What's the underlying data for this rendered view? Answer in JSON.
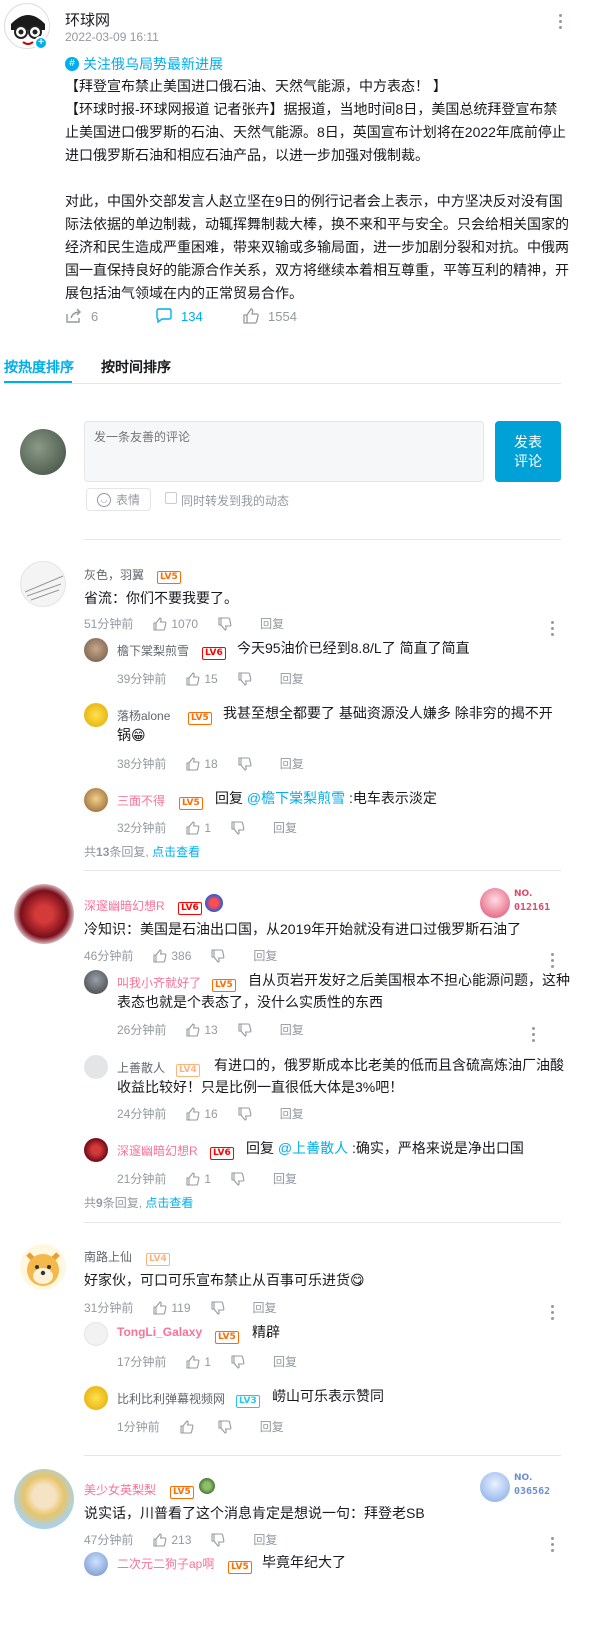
{
  "post": {
    "author": "环球网",
    "date": "2022-03-09 16:11",
    "topic": "关注俄乌局势最新进展",
    "paragraphs": [
      [
        "【拜登宣布禁止美国进口俄石油、天然气能源，中方表态！ 】"
      ],
      [
        "【环球时报-环球网报道 记者张卉】据报道，当地时间8日，美国总统拜登宣布禁",
        "止美国进口俄罗斯的石油、天然气能源。8日，英国宣布计划将在2022年底前停止",
        "进口俄罗斯石油和相应石油产品，以进一步加强对俄制裁。"
      ],
      [
        "对此，中国外交部发言人赵立坚在9日的例行记者会上表示，中方坚决反对没有国",
        "际法依据的单边制裁，动辄挥舞制裁大棒，换不来和平与安全。只会给相关国家的",
        "经济和民生造成严重困难，带来双输或多输局面，进一步加剧分裂和对抗。中俄两",
        "国一直保持良好的能源合作关系，双方将继续本着相互尊重，平等互利的精神，开",
        "展包括油气领域在内的正常贸易合作。"
      ]
    ],
    "share_count": "6",
    "comment_count": "134",
    "like_count": "1554"
  },
  "tabs": {
    "hot": "按热度排序",
    "time": "按时间排序"
  },
  "composer": {
    "placeholder": "发一条友善的评论",
    "submit_line1": "发表",
    "submit_line2": "评论",
    "emoji": "表情",
    "repost": "同时转发到我的动态"
  },
  "labels": {
    "reply": "回复",
    "view_prefix": "共",
    "view_suffix": "条回复,",
    "view_link": "点击查看"
  },
  "comments": [
    {
      "name": "灰色，羽翼",
      "level": "LV5",
      "text": "省流：你们不要我要了。",
      "time": "51分钟前",
      "likes": "1070",
      "replies": [
        {
          "name": "檐下棠梨煎雪",
          "level": "LV6",
          "line1": "今天95油价已经到8.8/L了 简直了简直",
          "line2": "",
          "time": "39分钟前",
          "likes": "15"
        },
        {
          "name": "落杨alone",
          "level": "LV5",
          "line1": "我甚至想全都要了   基础资源没人嫌多  除非穷的揭不开",
          "line2": "锅",
          "emoji": "😁",
          "time": "38分钟前",
          "likes": "18"
        },
        {
          "name": "三面不得",
          "level": "LV5",
          "prefix": "回复 ",
          "mention": "@檐下棠梨煎雪",
          "line1": " :电车表示淡定",
          "line2": "",
          "time": "32分钟前",
          "likes": "1"
        }
      ],
      "reply_total": "13"
    },
    {
      "name": "深邃幽暗幻想R",
      "level": "LV6",
      "text": "冷知识：美国是石油出口国，从2019年开始就没有进口过俄罗斯石油了",
      "time": "46分钟前",
      "likes": "386",
      "fan_no": "NO.",
      "fan_num": "012161",
      "replies": [
        {
          "name": "叫我小齐就好了",
          "level": "LV5",
          "line1": "自从页岩开发好之后美国根本不担心能源问题，这种",
          "line2": "表态也就是个表态了，没什么实质性的东西",
          "time": "26分钟前",
          "likes": "13"
        },
        {
          "name": "上善散人",
          "level": "LV4",
          "line1": "有进口的，俄罗斯成本比老美的低而且含硫高炼油厂油酸",
          "line2": "收益比较好！只是比例一直很低大体是3%吧！",
          "time": "24分钟前",
          "likes": "16"
        },
        {
          "name": "深邃幽暗幻想R",
          "level": "LV6",
          "prefix": "回复 ",
          "mention": "@上善散人",
          "line1": " :确实，严格来说是净出口国",
          "line2": "",
          "time": "21分钟前",
          "likes": "1"
        }
      ],
      "reply_total": "9"
    },
    {
      "name": "南路上仙",
      "level": "LV4",
      "text": "好家伙，可口可乐宣布禁止从百事可乐进货",
      "emoji": "😋",
      "time": "31分钟前",
      "likes": "119",
      "replies": [
        {
          "name": "TongLi_Galaxy",
          "level": "LV5",
          "line1": "精辟",
          "line2": "",
          "time": "17分钟前",
          "likes": "1"
        },
        {
          "name": "比利比利弹幕视频网",
          "level": "LV3",
          "line1": "崂山可乐表示赞同",
          "line2": "",
          "time": "1分钟前",
          "likes": ""
        }
      ]
    },
    {
      "name": "美少女英梨梨",
      "level": "LV5",
      "text": "说实话，川普看了这个消息肯定是想说一句：拜登老SB",
      "time": "47分钟前",
      "likes": "213",
      "fan_no": "NO.",
      "fan_num": "036562",
      "replies": [
        {
          "name": "二次元二狗子ap啊",
          "level": "LV5",
          "line1": "毕竟年纪大了",
          "line2": "",
          "time": "",
          "likes": ""
        }
      ]
    }
  ],
  "colors": {
    "accent": "#00aeec",
    "vip_pink": "#fb7299",
    "text": "#18191c",
    "muted": "#9499a0"
  }
}
